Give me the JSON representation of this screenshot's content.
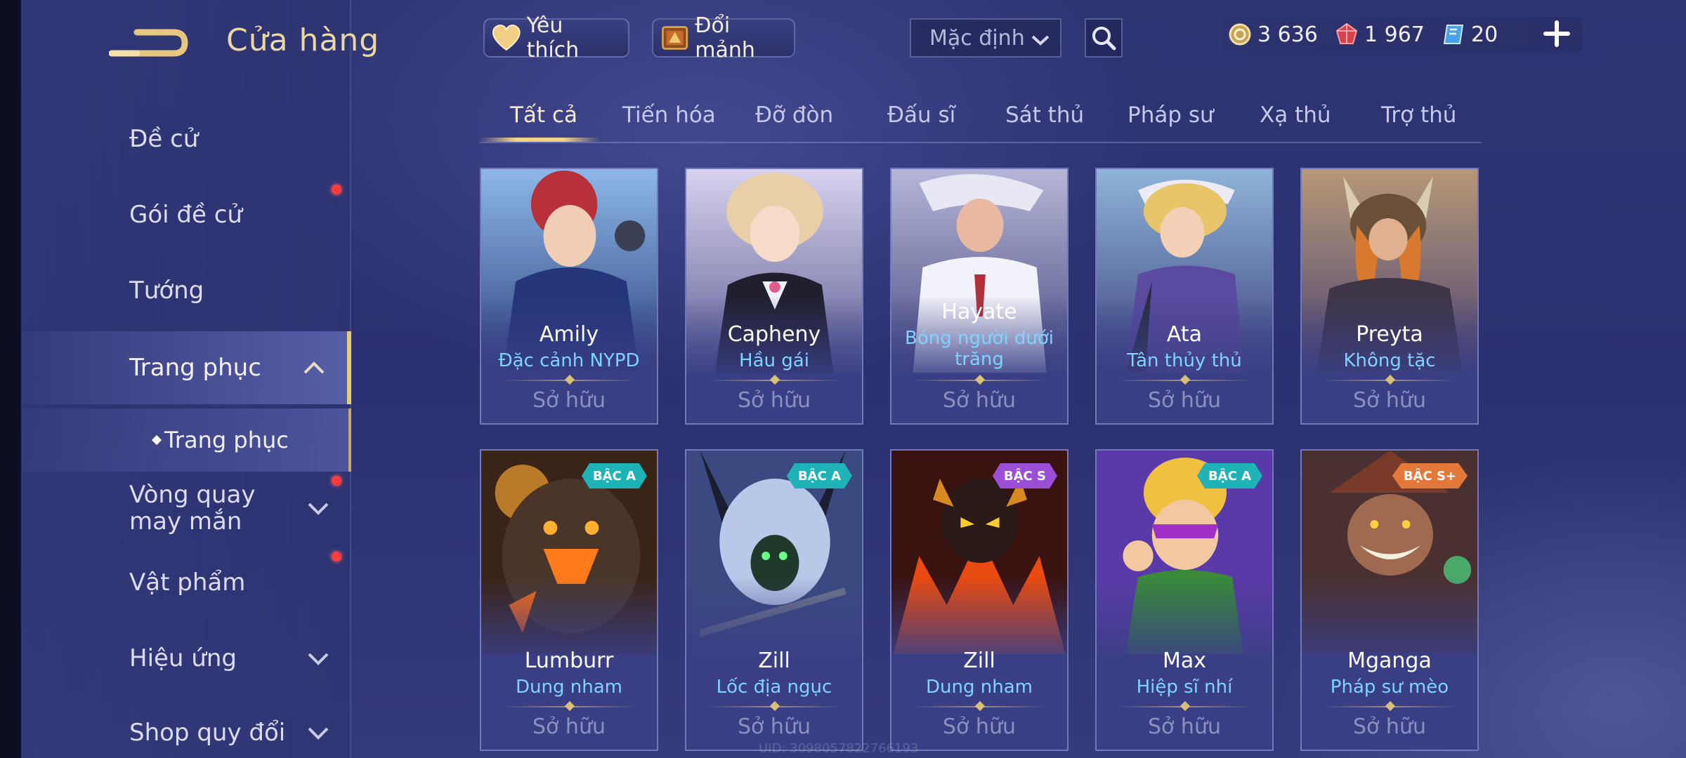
{
  "header": {
    "title": "Cửa hàng",
    "favorites_label": "Yêu thích",
    "exchange_label": "Đổi mảnh",
    "sort_value": "Mặc định"
  },
  "currency": {
    "gold": "3 636",
    "ruby": "1 967",
    "coupon": "20"
  },
  "sidebar": {
    "items": [
      {
        "label": "Đề cử"
      },
      {
        "label": "Gói đề cử"
      },
      {
        "label": "Tướng"
      },
      {
        "label": "Trang phục"
      },
      {
        "label": "Trang phục"
      },
      {
        "label": "Vòng quay may mắn"
      },
      {
        "label": "Vật phẩm"
      },
      {
        "label": "Hiệu ứng"
      },
      {
        "label": "Shop quy đổi"
      }
    ]
  },
  "tabs": [
    "Tất cả",
    "Tiến hóa",
    "Đỡ đòn",
    "Đấu sĩ",
    "Sát thủ",
    "Pháp sư",
    "Xạ thủ",
    "Trợ thủ"
  ],
  "cards": [
    {
      "hero": "Amily",
      "skin": "Đặc cảnh NYPD",
      "status": "Sở hữu",
      "badge": ""
    },
    {
      "hero": "Capheny",
      "skin": "Hầu gái",
      "status": "Sở hữu",
      "badge": ""
    },
    {
      "hero": "Hayate",
      "skin": "Bóng người dưới trăng",
      "status": "Sở hữu",
      "badge": ""
    },
    {
      "hero": "Ata",
      "skin": "Tân thủy thủ",
      "status": "Sở hữu",
      "badge": ""
    },
    {
      "hero": "Preyta",
      "skin": "Không tặc",
      "status": "Sở hữu",
      "badge": ""
    },
    {
      "hero": "Lumburr",
      "skin": "Dung nham",
      "status": "Sở hữu",
      "badge": "BẬC A"
    },
    {
      "hero": "Zill",
      "skin": "Lốc địa ngục",
      "status": "Sở hữu",
      "badge": "BẬC A"
    },
    {
      "hero": "Zill",
      "skin": "Dung nham",
      "status": "Sở hữu",
      "badge": "BẬC S"
    },
    {
      "hero": "Max",
      "skin": "Hiệp sĩ nhí",
      "status": "Sở hữu",
      "badge": "BẬC A"
    },
    {
      "hero": "Mganga",
      "skin": "Pháp sư mèo",
      "status": "Sở hữu",
      "badge": "BẬC S+"
    }
  ],
  "uid": "UID: 3098057822766193",
  "colors": {
    "accent_gold": "#e8c97a",
    "skin_name": "#7fd3ff",
    "badge_a": "#1fb3b8",
    "badge_s": "#9b4fd6",
    "badge_splus": "#e2793a",
    "notification": "#ff3b3b"
  }
}
